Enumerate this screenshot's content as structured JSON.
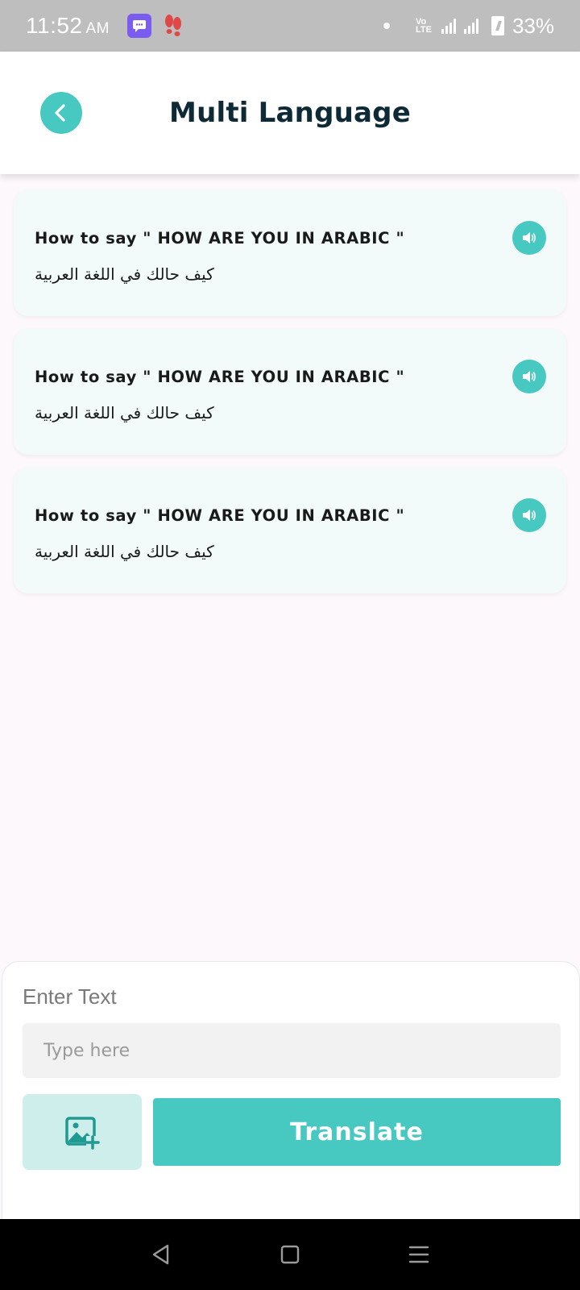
{
  "status_bar": {
    "time": "11:52",
    "ampm": "AM",
    "volte": "Vo LTE",
    "battery": "33%"
  },
  "header": {
    "title": "Multi Language",
    "back_icon": "chevron-left-icon"
  },
  "phrases": [
    {
      "question": "How to say \" HOW ARE YOU IN ARABIC \"",
      "answer": "كيف حالك في اللغة العربية",
      "icon": "speaker-icon"
    },
    {
      "question": "How to say \" HOW ARE YOU IN ARABIC \"",
      "answer": "كيف حالك في اللغة العربية",
      "icon": "speaker-icon"
    },
    {
      "question": "How to say \" HOW ARE YOU IN ARABIC \"",
      "answer": "كيف حالك في اللغة العربية",
      "icon": "speaker-icon"
    }
  ],
  "input": {
    "label": "Enter Text",
    "placeholder": "Type here",
    "value": ""
  },
  "actions": {
    "image_icon": "add-image-icon",
    "translate_label": "Translate"
  },
  "colors": {
    "accent": "#47c9c1",
    "accent_light": "#cdeeeb",
    "card_bg": "#f2fbfa",
    "title": "#0d2a36"
  }
}
